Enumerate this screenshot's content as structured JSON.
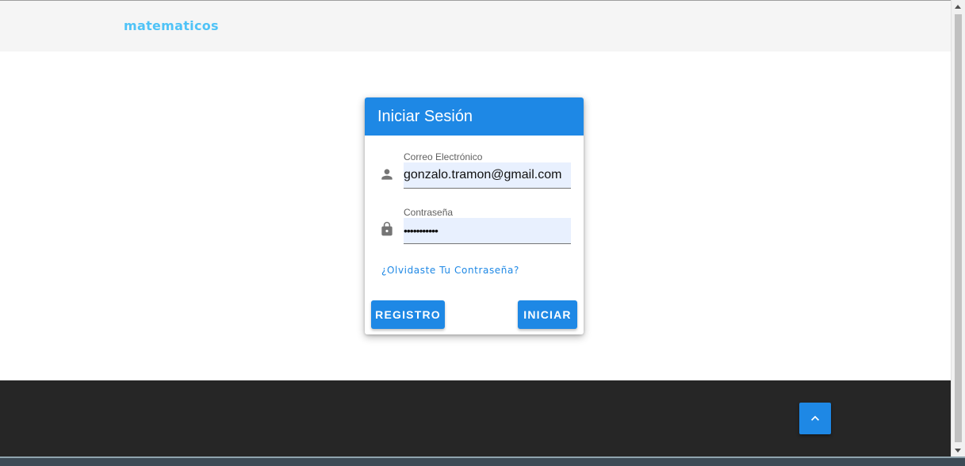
{
  "header": {
    "brand": "matematicos"
  },
  "login_card": {
    "title": "Iniciar Sesión",
    "email": {
      "label": "Correo Electrónico",
      "value": "gonzalo.tramon@gmail.com",
      "icon": "person-icon"
    },
    "password": {
      "label": "Contraseña",
      "value": "•••••••••••",
      "icon": "lock-icon"
    },
    "forgot_link": "¿Olvidaste Tu Contraseña?",
    "register_button": "REGISTRO",
    "login_button": "INICIAR"
  },
  "footer": {
    "scroll_top_icon": "chevron-up-icon"
  },
  "colors": {
    "primary": "#1e88e5",
    "brand": "#4fc3f7",
    "footer": "#262626",
    "input_bg": "#e8f0fe"
  }
}
